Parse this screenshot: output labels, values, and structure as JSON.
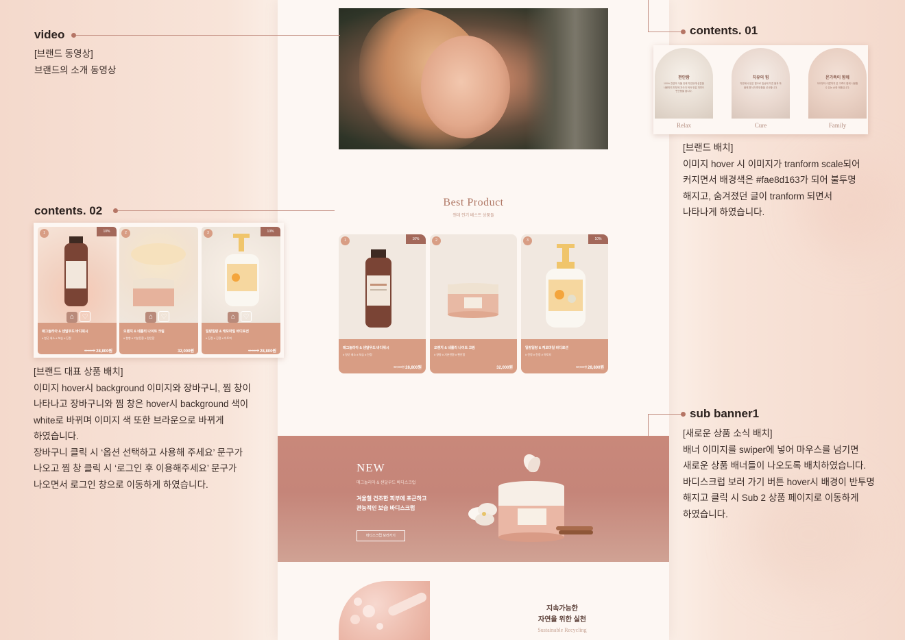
{
  "annotations": {
    "video": {
      "title": "video",
      "lines": [
        "[브랜드 동영상]",
        "브랜드의 소개 동영상"
      ]
    },
    "contents01": {
      "title": "contents. 01",
      "lines": [
        "[브랜드  배치]",
        "이미지 hover 시 이미지가 tranform scale되어",
        "커지면서 배경색은 #fae8d163가 되어 불투명",
        "해지고, 숨겨졌던 글이 tranform 되면서",
        "나타나게 하였습니다."
      ]
    },
    "contents02": {
      "title": "contents. 02",
      "lines": [
        "[브랜드 대표 상품 배치]",
        "이미지 hover시 background 이미지와 장바구니, 찜 창이",
        "나타나고 장바구니와 찜 창은 hover시 background 색이",
        "white로 바뀌며 이미지 색 또한 브라운으로  바뀌게",
        "하였습니다.",
        "장바구니 클릭 시 ‘옵션 선택하고 사용해 주세요’ 문구가",
        "나오고 찜 창 클릭 시 ‘로그인 후 이용해주세요’ 문구가",
        "나오면서 로그인 창으로 이동하게 하였습니다."
      ]
    },
    "subbanner1": {
      "title": "sub banner1",
      "lines": [
        "[새로운 상품 소식 배치]",
        "배너 이미지를 swiper에 넣어 마우스를 넘기면",
        "새로운 상품 배너들이 나오도록 배치하였습니다.",
        "바디스크럽 보러 가기 버튼 hover시  배경이 반투명",
        "해지고 클릭 시 Sub 2 상품 페이지로 이동하게",
        "하였습니다."
      ]
    }
  },
  "contents01_preview": {
    "items": [
      {
        "title": "편안함",
        "desc": "100% 천연의 식물 유래 자연유래 성분을 사용하여 피부에 자극이 적어 민감 피부도 편안함을 줍니다.",
        "label": "Relax"
      },
      {
        "title": "치유의 힘",
        "desc": "자연에서 얻은 힘으로 일상에 지친 몸과 마음에 휴식과 편안함을 선사합니다.",
        "label": "Cure"
      },
      {
        "title": "온가족이 함께",
        "desc": "아이부터 어른까지 온 가족이 함께 사용할 수 있는 순한 제품입니다.",
        "label": "Family"
      }
    ]
  },
  "best_product": {
    "title": "Best Product",
    "subtitle": "앤데 인기 베스트 상품들",
    "products": [
      {
        "rank": "1",
        "discount": "10%",
        "name": "매그놀리아 & 샌달우드 바디워시",
        "tags": "# 향긋 세소  # 보습  # 진정",
        "old_price": "32,000원",
        "price": "28,800원"
      },
      {
        "rank": "2",
        "discount": "",
        "name": "오렌지 & 네롤리 나이트 크림",
        "tags": "# 향향  # 기분전환  # 편안함",
        "old_price": "",
        "price": "32,000원"
      },
      {
        "rank": "3",
        "discount": "10%",
        "name": "일랑일랑 & 캐모마일 바디로션",
        "tags": "# 진정  # 진정  # 아토피",
        "old_price": "32,000원",
        "price": "28,800원"
      }
    ]
  },
  "banner": {
    "new_label": "NEW",
    "caption": "매그놀리아 & 샌달우드 바디스크럽",
    "line1": "겨울철 건조한 피부에 포근하고",
    "line2": "관능적인 보습 바디스크럽",
    "button": "바디스크럽 보러가기"
  },
  "sustainable": {
    "line1": "지속가능한",
    "line2": "자연을 위한 실천",
    "en": "Sustainable Recycling"
  },
  "colors": {
    "accent": "#d89d84",
    "discount": "#a3685a",
    "banner": "#c58579",
    "dot": "#b57565"
  }
}
